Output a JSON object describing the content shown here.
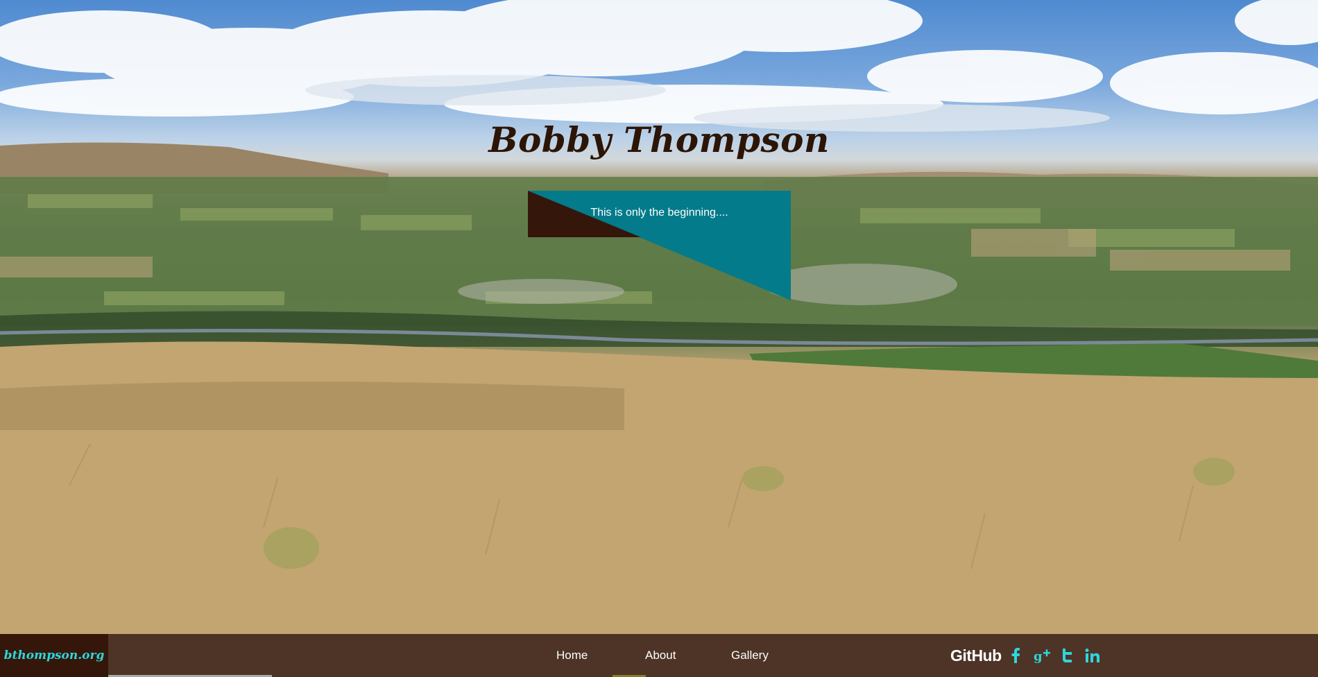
{
  "header": {
    "title": "Bobby Thompson",
    "tagline": "This is only the beginning...."
  },
  "footer": {
    "brand": "bthompson.org",
    "nav": [
      {
        "label": "Home"
      },
      {
        "label": "About"
      },
      {
        "label": "Gallery"
      }
    ],
    "social": {
      "github_label": "GitHub",
      "icons": [
        "facebook-icon",
        "google-plus-icon",
        "twitter-icon",
        "linkedin-icon"
      ]
    }
  },
  "colors": {
    "title": "#2c1506",
    "banner_teal": "#047b8a",
    "banner_dark": "#34170a",
    "footer_bg": "#4d3426",
    "brand_bg": "#34170a",
    "brand_text": "#2fd5dc",
    "social_icons": "#2fd5dc"
  }
}
